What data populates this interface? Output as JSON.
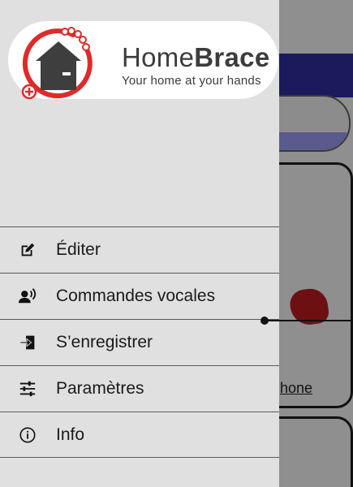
{
  "brand": {
    "name_light": "Home",
    "name_bold": "Brace",
    "tagline": "Your home at your hands"
  },
  "menu": [
    {
      "label": "Éditer",
      "icon": "edit-icon"
    },
    {
      "label": "Commandes vocales",
      "icon": "voice-command-icon"
    },
    {
      "label": "S’enregistrer",
      "icon": "login-icon"
    },
    {
      "label": "Paramètres",
      "icon": "settings-sliders-icon"
    },
    {
      "label": "Info",
      "icon": "info-icon"
    }
  ],
  "background": {
    "link_text": "hone"
  },
  "colors": {
    "drawer_bg": "#e0e0e0",
    "navbar": "#1b1a5c",
    "logo_red": "#e02a2a",
    "logo_house": "#3e3e3e"
  }
}
